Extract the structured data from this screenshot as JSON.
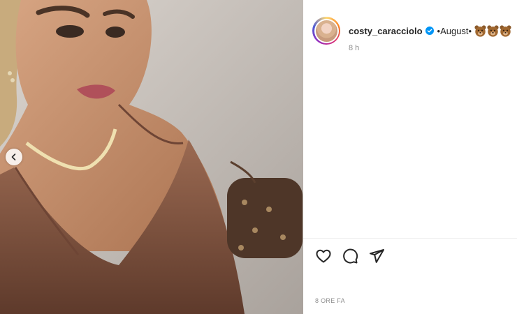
{
  "post": {
    "username": "costy_caracciolo",
    "caption": "•August•",
    "emojis": [
      "bear-emoji",
      "bear-emoji",
      "bear-emoji"
    ],
    "time_short": "8 h",
    "time_long": "8 ORE FA"
  },
  "icons": {
    "verified": "verified-badge-icon",
    "prev": "chevron-left-icon",
    "like": "heart-icon",
    "comment": "comment-icon",
    "share": "paper-plane-icon"
  },
  "colors": {
    "verified_blue": "#0095f6",
    "text_primary": "#262626",
    "text_secondary": "#8e8e8e"
  }
}
